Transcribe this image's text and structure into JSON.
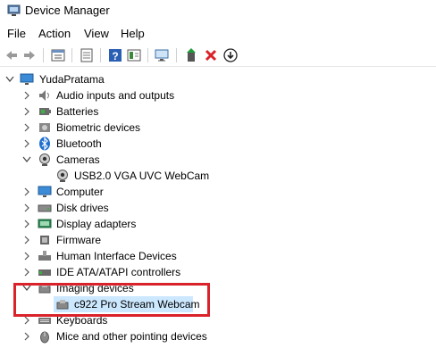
{
  "window": {
    "title": "Device Manager"
  },
  "menu": {
    "items": [
      "File",
      "Action",
      "View",
      "Help"
    ]
  },
  "toolbar": {
    "buttons": [
      "back-icon",
      "forward-icon",
      "properties-icon",
      "update-driver-list-icon",
      "help-icon",
      "view-icon",
      "monitor-scan-icon",
      "enable-device-icon",
      "uninstall-icon",
      "download-icon"
    ]
  },
  "tree": {
    "root": "YudaPratama",
    "items": [
      {
        "label": "Audio inputs and outputs",
        "icon": "speaker-icon"
      },
      {
        "label": "Batteries",
        "icon": "battery-icon"
      },
      {
        "label": "Biometric devices",
        "icon": "biometric-icon"
      },
      {
        "label": "Bluetooth",
        "icon": "bluetooth-icon"
      },
      {
        "label": "Cameras",
        "icon": "camera-icon",
        "expanded": true
      },
      {
        "label": "USB2.0 VGA UVC WebCam",
        "icon": "webcam-icon",
        "child": true
      },
      {
        "label": "Computer",
        "icon": "computer-icon"
      },
      {
        "label": "Disk drives",
        "icon": "disk-icon"
      },
      {
        "label": "Display adapters",
        "icon": "display-adapter-icon"
      },
      {
        "label": "Firmware",
        "icon": "firmware-icon"
      },
      {
        "label": "Human Interface Devices",
        "icon": "hid-icon"
      },
      {
        "label": "IDE ATA/ATAPI controllers",
        "icon": "ide-controller-icon"
      },
      {
        "label": "Imaging devices",
        "icon": "imaging-icon",
        "expanded": true
      },
      {
        "label": "c922 Pro Stream Webcam",
        "icon": "imaging-device-icon",
        "child": true,
        "selected": true
      },
      {
        "label": "Keyboards",
        "icon": "keyboard-icon"
      },
      {
        "label": "Mice and other pointing devices",
        "icon": "mouse-icon"
      }
    ]
  },
  "colors": {
    "selection": "#cce8ff",
    "highlight_border": "#d9222a"
  }
}
